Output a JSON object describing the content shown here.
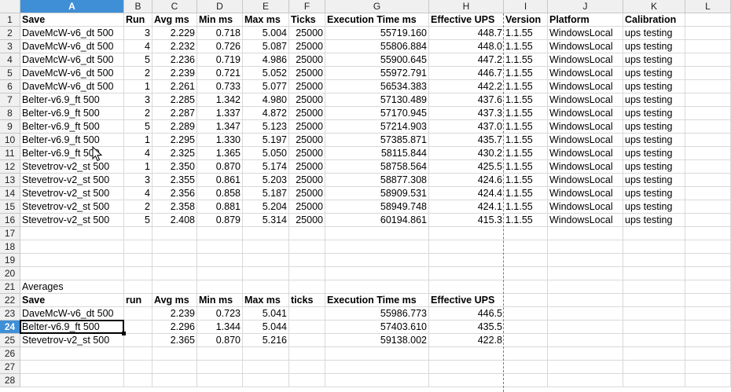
{
  "sheet": {
    "columns": [
      "A",
      "B",
      "C",
      "D",
      "E",
      "F",
      "G",
      "H",
      "I",
      "J",
      "K",
      "L"
    ],
    "active_column": "A",
    "active_row": 24,
    "row_count": 28,
    "rows": {
      "1": [
        "Save",
        "Run",
        "Avg ms",
        "Min ms",
        "Max ms",
        "Ticks",
        "Execution Time ms",
        "Effective UPS",
        "Version",
        "Platform",
        "Calibration",
        ""
      ],
      "2": [
        "DaveMcW-v6_dt 500",
        "3",
        "2.229",
        "0.718",
        "5.004",
        "25000",
        "55719.160",
        "448.7",
        "1.1.55",
        "WindowsLocal",
        "ups testing",
        ""
      ],
      "3": [
        "DaveMcW-v6_dt 500",
        "4",
        "2.232",
        "0.726",
        "5.087",
        "25000",
        "55806.884",
        "448.0",
        "1.1.55",
        "WindowsLocal",
        "ups testing",
        ""
      ],
      "4": [
        "DaveMcW-v6_dt 500",
        "5",
        "2.236",
        "0.719",
        "4.986",
        "25000",
        "55900.645",
        "447.2",
        "1.1.55",
        "WindowsLocal",
        "ups testing",
        ""
      ],
      "5": [
        "DaveMcW-v6_dt 500",
        "2",
        "2.239",
        "0.721",
        "5.052",
        "25000",
        "55972.791",
        "446.7",
        "1.1.55",
        "WindowsLocal",
        "ups testing",
        ""
      ],
      "6": [
        "DaveMcW-v6_dt 500",
        "1",
        "2.261",
        "0.733",
        "5.077",
        "25000",
        "56534.383",
        "442.2",
        "1.1.55",
        "WindowsLocal",
        "ups testing",
        ""
      ],
      "7": [
        "Belter-v6.9_ft 500",
        "3",
        "2.285",
        "1.342",
        "4.980",
        "25000",
        "57130.489",
        "437.6",
        "1.1.55",
        "WindowsLocal",
        "ups testing",
        ""
      ],
      "8": [
        "Belter-v6.9_ft 500",
        "2",
        "2.287",
        "1.337",
        "4.872",
        "25000",
        "57170.945",
        "437.3",
        "1.1.55",
        "WindowsLocal",
        "ups testing",
        ""
      ],
      "9": [
        "Belter-v6.9_ft 500",
        "5",
        "2.289",
        "1.347",
        "5.123",
        "25000",
        "57214.903",
        "437.0",
        "1.1.55",
        "WindowsLocal",
        "ups testing",
        ""
      ],
      "10": [
        "Belter-v6.9_ft 500",
        "1",
        "2.295",
        "1.330",
        "5.197",
        "25000",
        "57385.871",
        "435.7",
        "1.1.55",
        "WindowsLocal",
        "ups testing",
        ""
      ],
      "11": [
        "Belter-v6.9_ft 500",
        "4",
        "2.325",
        "1.365",
        "5.050",
        "25000",
        "58115.844",
        "430.2",
        "1.1.55",
        "WindowsLocal",
        "ups testing",
        ""
      ],
      "12": [
        "Stevetrov-v2_st 500",
        "1",
        "2.350",
        "0.870",
        "5.174",
        "25000",
        "58758.564",
        "425.5",
        "1.1.55",
        "WindowsLocal",
        "ups testing",
        ""
      ],
      "13": [
        "Stevetrov-v2_st 500",
        "3",
        "2.355",
        "0.861",
        "5.203",
        "25000",
        "58877.308",
        "424.6",
        "1.1.55",
        "WindowsLocal",
        "ups testing",
        ""
      ],
      "14": [
        "Stevetrov-v2_st 500",
        "4",
        "2.356",
        "0.858",
        "5.187",
        "25000",
        "58909.531",
        "424.4",
        "1.1.55",
        "WindowsLocal",
        "ups testing",
        ""
      ],
      "15": [
        "Stevetrov-v2_st 500",
        "2",
        "2.358",
        "0.881",
        "5.204",
        "25000",
        "58949.748",
        "424.1",
        "1.1.55",
        "WindowsLocal",
        "ups testing",
        ""
      ],
      "16": [
        "Stevetrov-v2_st 500",
        "5",
        "2.408",
        "0.879",
        "5.314",
        "25000",
        "60194.861",
        "415.3",
        "1.1.55",
        "WindowsLocal",
        "ups testing",
        ""
      ],
      "21": [
        "Averages",
        "",
        "",
        "",
        "",
        "",
        "",
        "",
        "",
        "",
        "",
        ""
      ],
      "22": [
        "Save",
        "run",
        "Avg ms",
        "Min ms",
        "Max ms",
        "ticks",
        "Execution Time ms",
        "Effective UPS",
        "",
        "",
        "",
        ""
      ],
      "23": [
        "DaveMcW-v6_dt 500",
        "",
        "2.239",
        "0.723",
        "5.041",
        "",
        "55986.773",
        "446.5",
        "",
        "",
        "",
        ""
      ],
      "24": [
        "Belter-v6.9_ft 500",
        "",
        "2.296",
        "1.344",
        "5.044",
        "",
        "57403.610",
        "435.5",
        "",
        "",
        "",
        ""
      ],
      "25": [
        "Stevetrov-v2_st 500",
        "",
        "2.365",
        "0.870",
        "5.216",
        "",
        "59138.002",
        "422.8",
        "",
        "",
        "",
        ""
      ]
    },
    "colors": {
      "header_bg": "#f0f0f0",
      "active_header": "#3f8fd6",
      "grid": "#d9d9d9"
    }
  }
}
